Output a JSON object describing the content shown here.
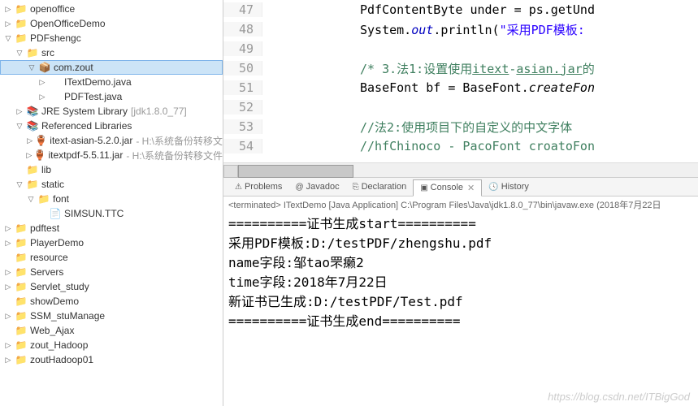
{
  "tree": {
    "items": [
      {
        "pad": "pad0",
        "exp": "▷",
        "icon": "📁",
        "iconcls": "ico-folder",
        "label": "openoffice",
        "sel": false
      },
      {
        "pad": "pad0",
        "exp": "▷",
        "icon": "📁",
        "iconcls": "ico-folder",
        "label": "OpenOfficeDemo",
        "sel": false
      },
      {
        "pad": "pad0",
        "exp": "▽",
        "icon": "📁",
        "iconcls": "ico-folder",
        "label": "PDFshengc",
        "sel": false
      },
      {
        "pad": "pad1",
        "exp": "▽",
        "icon": "📁",
        "iconcls": "ico-folder",
        "label": "src",
        "sel": false
      },
      {
        "pad": "pad2",
        "exp": "▽",
        "icon": "📦",
        "iconcls": "ico-package",
        "label": "com.zout",
        "sel": true
      },
      {
        "pad": "pad3",
        "exp": "▷",
        "icon": "🷀",
        "iconcls": "ico-java",
        "label": "ITextDemo.java",
        "sel": false
      },
      {
        "pad": "pad3",
        "exp": "▷",
        "icon": "🷀",
        "iconcls": "ico-java",
        "label": "PDFTest.java",
        "sel": false
      },
      {
        "pad": "pad1",
        "exp": "▷",
        "icon": "📚",
        "iconcls": "ico-lib",
        "label": "JRE System Library",
        "dim": "[jdk1.8.0_77]",
        "sel": false
      },
      {
        "pad": "pad1",
        "exp": "▽",
        "icon": "📚",
        "iconcls": "ico-lib",
        "label": "Referenced Libraries",
        "sel": false
      },
      {
        "pad": "pad2",
        "exp": "▷",
        "icon": "🏺",
        "iconcls": "ico-jar",
        "label": "itext-asian-5.2.0.jar",
        "dim": "- H:\\系统备份转移文",
        "sel": false
      },
      {
        "pad": "pad2",
        "exp": "▷",
        "icon": "🏺",
        "iconcls": "ico-jar",
        "label": "itextpdf-5.5.11.jar",
        "dim": "- H:\\系统备份转移文件",
        "sel": false
      },
      {
        "pad": "pad1",
        "exp": "",
        "icon": "📁",
        "iconcls": "ico-folder",
        "label": "lib",
        "sel": false
      },
      {
        "pad": "pad1",
        "exp": "▽",
        "icon": "📁",
        "iconcls": "ico-folder",
        "label": "static",
        "sel": false
      },
      {
        "pad": "pad2",
        "exp": "▽",
        "icon": "📁",
        "iconcls": "ico-folder",
        "label": "font",
        "sel": false
      },
      {
        "pad": "pad3",
        "exp": "",
        "icon": "📄",
        "iconcls": "ico-file",
        "label": "SIMSUN.TTC",
        "sel": false
      },
      {
        "pad": "pad0",
        "exp": "▷",
        "icon": "📁",
        "iconcls": "ico-folder",
        "label": "pdftest",
        "sel": false
      },
      {
        "pad": "pad0",
        "exp": "▷",
        "icon": "📁",
        "iconcls": "ico-folder",
        "label": "PlayerDemo",
        "sel": false
      },
      {
        "pad": "pad0",
        "exp": "",
        "icon": "📁",
        "iconcls": "ico-folder",
        "label": "resource",
        "sel": false
      },
      {
        "pad": "pad0",
        "exp": "▷",
        "icon": "📁",
        "iconcls": "ico-folder",
        "label": "Servers",
        "sel": false
      },
      {
        "pad": "pad0",
        "exp": "▷",
        "icon": "📁",
        "iconcls": "ico-folder",
        "label": "Servlet_study",
        "sel": false
      },
      {
        "pad": "pad0",
        "exp": "",
        "icon": "📁",
        "iconcls": "ico-folder",
        "label": "showDemo",
        "sel": false
      },
      {
        "pad": "pad0",
        "exp": "▷",
        "icon": "📁",
        "iconcls": "ico-folder",
        "label": "SSM_stuManage",
        "sel": false
      },
      {
        "pad": "pad0",
        "exp": "",
        "icon": "📁",
        "iconcls": "ico-folder",
        "label": "Web_Ajax",
        "sel": false
      },
      {
        "pad": "pad0",
        "exp": "▷",
        "icon": "📁",
        "iconcls": "ico-folder",
        "label": "zout_Hadoop",
        "sel": false
      },
      {
        "pad": "pad0",
        "exp": "▷",
        "icon": "📁",
        "iconcls": "ico-folder",
        "label": "zoutHadoop01",
        "sel": false
      }
    ]
  },
  "editor": {
    "lines": [
      {
        "num": "47",
        "html": "PdfContentByte <span class='type'>under</span> = ps.getUnd"
      },
      {
        "num": "48",
        "html": "System.<span class='static-field'>out</span>.println(<span class='str'>\"采用PDF模板:</span>"
      },
      {
        "num": "49",
        "html": ""
      },
      {
        "num": "50",
        "html": "<span class='comment'>/* 3.法1:设置使用<u>itext</u>-<u>asian.jar</u>的</span>"
      },
      {
        "num": "51",
        "html": "BaseFont <span class='type'>bf</span> = BaseFont.<span class='method'>createFon</span>"
      },
      {
        "num": "52",
        "html": ""
      },
      {
        "num": "53",
        "html": "<span class='comment'>//法2:使用项目下的自定义的中文字体</span>"
      },
      {
        "num": "54",
        "html": "<span class='comment'>//hfChinoco - PacoFont croatoFon</span>"
      }
    ]
  },
  "tabs": {
    "items": [
      {
        "icon": "⚠",
        "label": "Problems",
        "active": false
      },
      {
        "icon": "@",
        "label": "Javadoc",
        "active": false
      },
      {
        "icon": "⎘",
        "label": "Declaration",
        "active": false
      },
      {
        "icon": "▣",
        "label": "Console",
        "active": true,
        "close": "✕"
      },
      {
        "icon": "🕓",
        "label": "History",
        "active": false
      }
    ]
  },
  "status": "<terminated> ITextDemo [Java Application] C:\\Program Files\\Java\\jdk1.8.0_77\\bin\\javaw.exe (2018年7月22日",
  "console": {
    "lines": [
      "==========证书生成start==========",
      "采用PDF模板:D:/testPDF/zhengshu.pdf",
      "name字段:邹tao罘癞2",
      "time字段:2018年7月22日",
      "新证书已生成:D:/testPDF/Test.pdf",
      "==========证书生成end=========="
    ]
  },
  "watermark": "https://blog.csdn.net/ITBigGod"
}
